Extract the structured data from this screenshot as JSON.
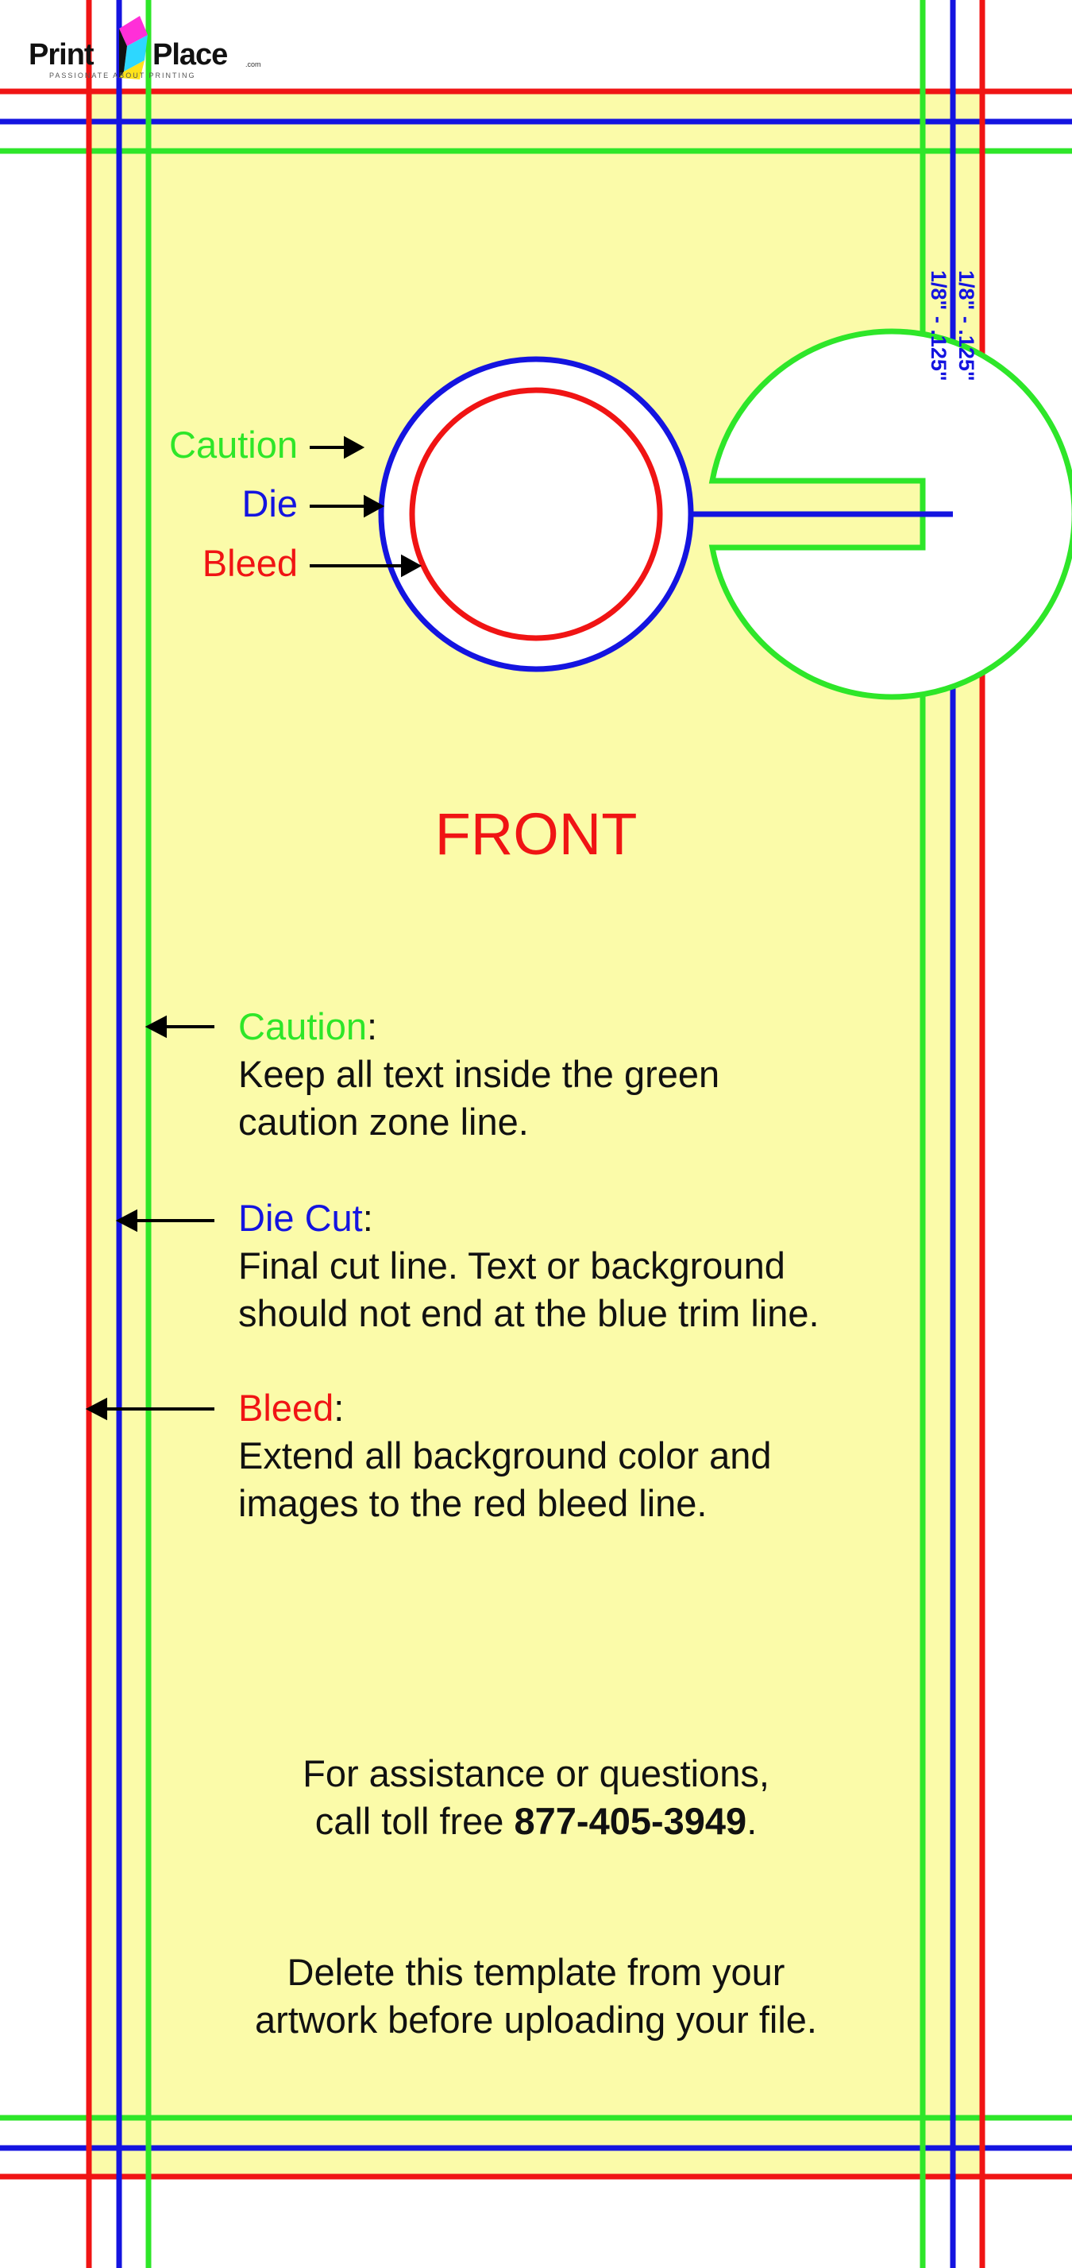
{
  "logo": {
    "brand_left": "Print",
    "brand_right": "Place",
    "domain_suffix": ".com",
    "tagline": "PASSIONATE ABOUT PRINTING"
  },
  "measures": {
    "outer": "1/8\" - .125\"",
    "inner": "1/8\" - .125\""
  },
  "hole_callouts": {
    "caution": "Caution",
    "die": "Die",
    "bleed": "Bleed"
  },
  "side_label": "FRONT",
  "legend": {
    "caution": {
      "title": "Caution",
      "colon": ":",
      "line1": "Keep all text inside the green",
      "line2": "caution zone line."
    },
    "die_cut": {
      "title": "Die Cut",
      "colon": ":",
      "line1": "Final cut line. Text or background",
      "line2": "should not end at the blue trim line."
    },
    "bleed": {
      "title": "Bleed",
      "colon": ":",
      "line1": "Extend all background color and",
      "line2": "images to the red bleed line."
    }
  },
  "assistance": {
    "line1": "For assistance or questions,",
    "line2_prefix": "call toll free ",
    "phone": "877-405-3949",
    "line2_suffix": "."
  },
  "notice": {
    "line1": "Delete this template from your",
    "line2": "artwork before uploading your file."
  },
  "colors": {
    "caution": "#2ee629",
    "die": "#1414e0",
    "bleed": "#f01414",
    "safe_area": "#fbfba9"
  }
}
